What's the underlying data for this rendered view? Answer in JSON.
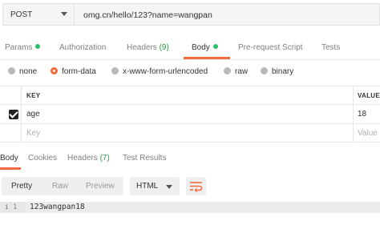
{
  "request": {
    "method": "POST",
    "url": "omg.cn/hello/123?name=wangpan"
  },
  "request_tabs": [
    {
      "label": "Params",
      "dot": true
    },
    {
      "label": "Authorization"
    },
    {
      "label": "Headers",
      "count": "(9)"
    },
    {
      "label": "Body",
      "dot": true,
      "active": true
    },
    {
      "label": "Pre-request Script"
    },
    {
      "label": "Tests"
    }
  ],
  "body_types": [
    {
      "label": "none"
    },
    {
      "label": "form-data",
      "selected": true
    },
    {
      "label": "x-www-form-urlencoded"
    },
    {
      "label": "raw"
    },
    {
      "label": "binary"
    }
  ],
  "params_table": {
    "headers": {
      "key": "KEY",
      "value": "VALUE"
    },
    "rows": [
      {
        "checked": true,
        "key": "age",
        "value": "18"
      }
    ],
    "placeholder": {
      "key": "Key",
      "value": "Value"
    }
  },
  "response_tabs": [
    {
      "label": "Body",
      "active": true
    },
    {
      "label": "Cookies"
    },
    {
      "label": "Headers",
      "count": "(7)"
    },
    {
      "label": "Test Results"
    }
  ],
  "response_toolbar": {
    "modes": [
      "Pretty",
      "Raw",
      "Preview"
    ],
    "format": "HTML"
  },
  "response_body": {
    "line_number": "1",
    "info_marker": "i",
    "text": "123wangpan18"
  },
  "colors": {
    "accent": "#f26b3a",
    "dot_green": "#2ebd6b",
    "count_green": "#2a9d4a"
  }
}
